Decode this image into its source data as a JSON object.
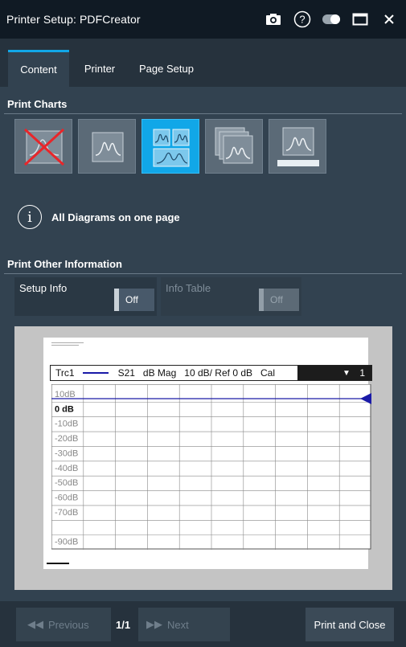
{
  "window": {
    "title": "Printer Setup: PDFCreator"
  },
  "titlebar_icons": [
    "camera-icon",
    "help-icon",
    "toggle-icon",
    "maximize-icon",
    "close-icon"
  ],
  "tabs": [
    {
      "label": "Content",
      "active": true
    },
    {
      "label": "Printer",
      "active": false
    },
    {
      "label": "Page Setup",
      "active": false
    }
  ],
  "print_charts": {
    "header": "Print Charts",
    "options": [
      "no-diagrams",
      "active-diagram",
      "all-diagrams-one-page",
      "all-diagrams-separate-pages",
      "active-diagram-with-info"
    ],
    "selected_index": 2,
    "info_text": "All Diagrams on one page"
  },
  "print_other": {
    "header": "Print Other Information",
    "setup_info": {
      "label": "Setup Info",
      "value": "Off"
    },
    "info_table": {
      "label": "Info Table",
      "value": "Off",
      "disabled": true
    }
  },
  "preview": {
    "trace": {
      "name": "Trc1",
      "param": "S21",
      "format": "dB Mag",
      "scale": "10 dB/ Ref 0 dB",
      "cal": "Cal",
      "channel": "1"
    },
    "y_ticks": [
      "10dB",
      "0 dB",
      "-10dB",
      "-20dB",
      "-30dB",
      "-40dB",
      "-50dB",
      "-60dB",
      "-70dB",
      "",
      "-90dB"
    ],
    "trace_color": "#1a1aa8"
  },
  "footer": {
    "previous": "Previous",
    "page": "1/1",
    "next": "Next",
    "print_close": "Print and Close"
  },
  "colors": {
    "accent": "#11a7e8",
    "background": "#324250",
    "titlebar": "#101a24"
  }
}
